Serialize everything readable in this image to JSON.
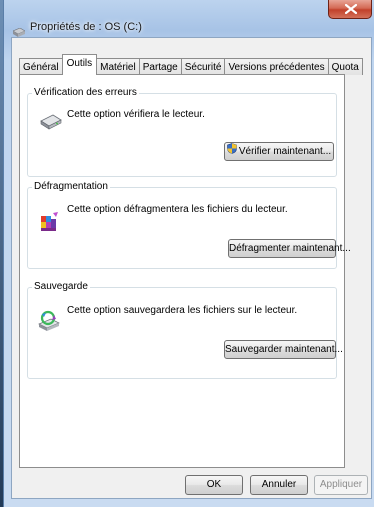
{
  "window": {
    "title": "Propriétés de : OS (C:)"
  },
  "tabs": [
    {
      "label": "Général",
      "active": false
    },
    {
      "label": "Outils",
      "active": true
    },
    {
      "label": "Matériel",
      "active": false
    },
    {
      "label": "Partage",
      "active": false
    },
    {
      "label": "Sécurité",
      "active": false
    },
    {
      "label": "Versions précédentes",
      "active": false
    },
    {
      "label": "Quota",
      "active": false
    }
  ],
  "groups": {
    "error_check": {
      "title": "Vérification des erreurs",
      "description": "Cette option vérifiera le lecteur.",
      "button": "Vérifier maintenant...",
      "icon": "drive-icon"
    },
    "defrag": {
      "title": "Défragmentation",
      "description": "Cette option défragmentera les fichiers du lecteur.",
      "button": "Défragmenter maintenant...",
      "icon": "defrag-icon"
    },
    "backup": {
      "title": "Sauvegarde",
      "description": "Cette option sauvegardera les fichiers sur le lecteur.",
      "button": "Sauvegarder maintenant...",
      "icon": "backup-icon"
    }
  },
  "footer": {
    "ok": "OK",
    "cancel": "Annuler",
    "apply": "Appliquer"
  },
  "colors": {
    "close_button": "#c2412a",
    "accent": "#a7c3e6"
  }
}
